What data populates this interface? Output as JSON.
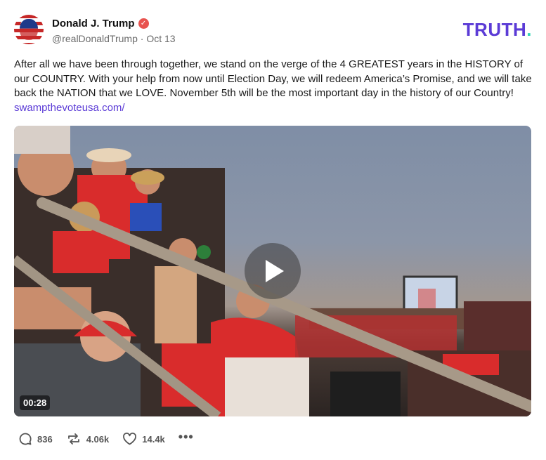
{
  "post": {
    "author": {
      "display_name": "Donald J. Trump",
      "verified_mark": "✓",
      "handle": "@realDonaldTrump",
      "separator": "·",
      "date": "Oct 13"
    },
    "brand": {
      "logo_text": "TRUTH",
      "logo_dot": ".",
      "logo_color": "#5b3bd6",
      "dot_color": "#33d6b5"
    },
    "text": "After all we have been through together, we stand on the verge of the 4 GREATEST years in the HISTORY of our COUNTRY. With your help from now until Election Day, we will redeem America’s Promise, and we will take back the NATION that we LOVE. November 5th will be the most important day in the history of our Country!",
    "link": "swampthevoteusa.com/",
    "video": {
      "duration": "00:28"
    },
    "actions": {
      "replies": "836",
      "retruths": "4.06k",
      "likes": "14.4k",
      "more": "•••"
    }
  }
}
